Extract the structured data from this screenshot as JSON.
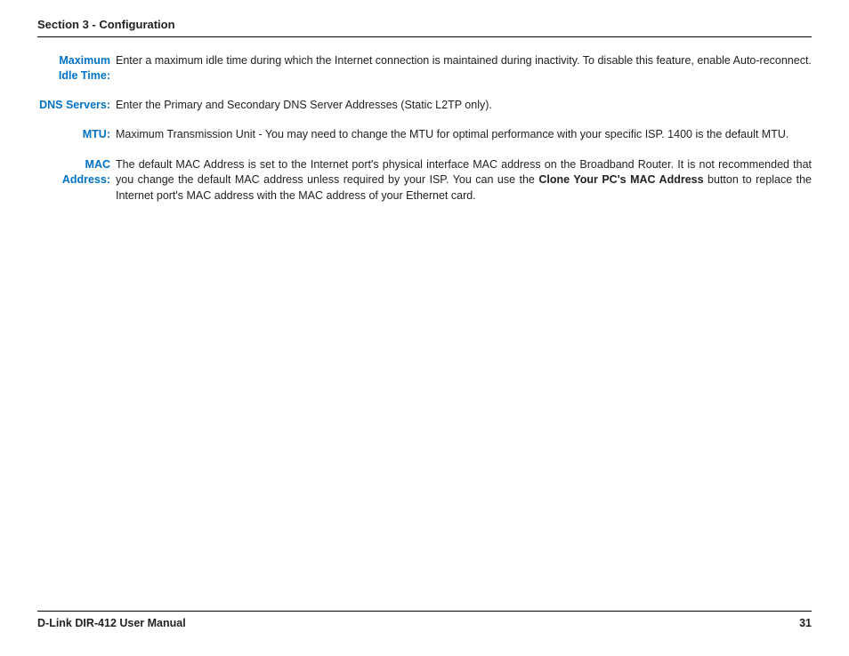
{
  "header": {
    "title": "Section 3 - Configuration"
  },
  "rows": {
    "idle": {
      "label": "Maximum Idle Time:",
      "desc": "Enter a maximum idle time during which the Internet connection is maintained during inactivity. To disable this feature, enable Auto-reconnect."
    },
    "dns": {
      "label": "DNS Servers:",
      "desc": "Enter the Primary and Secondary DNS Server Addresses (Static L2TP only)."
    },
    "mtu": {
      "label": "MTU:",
      "desc": "Maximum Transmission Unit - You may need to change the MTU for optimal performance with your specific ISP. 1400 is the default MTU."
    },
    "mac": {
      "label": "MAC Address:",
      "desc_pre": "The default MAC Address is set to the Internet port's physical interface MAC address on the Broadband Router. It is not recommended that you change the default MAC address unless required by your ISP. You can use the ",
      "desc_bold": "Clone Your PC's MAC Address",
      "desc_post": " button to replace the Internet port's MAC address with the MAC address of your Ethernet card."
    }
  },
  "footer": {
    "left": "D-Link DIR-412 User Manual",
    "right": "31"
  }
}
